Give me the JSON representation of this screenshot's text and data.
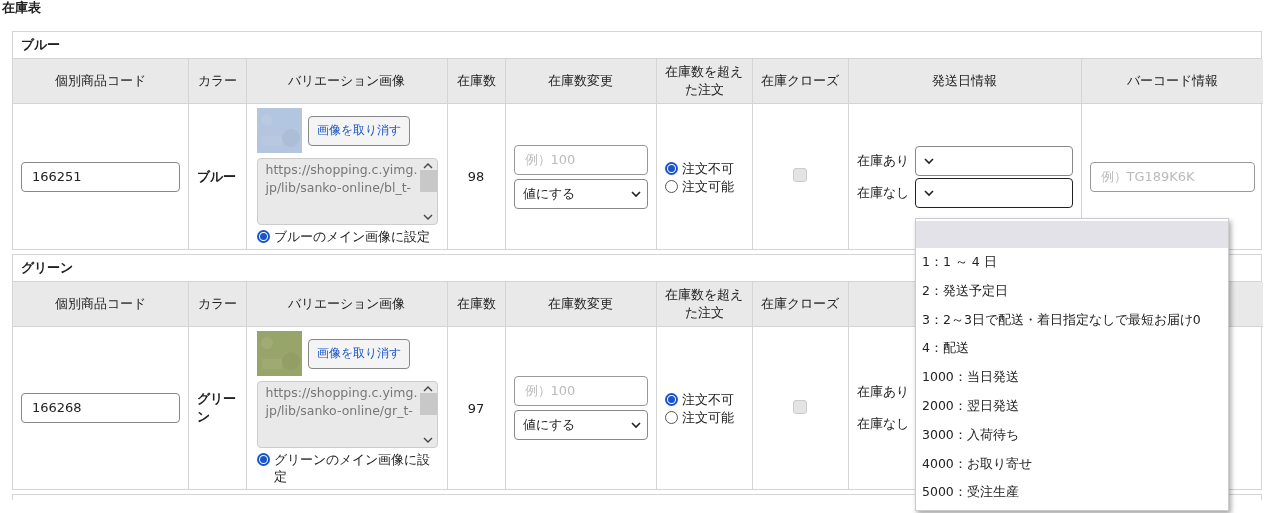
{
  "page_title": "在庫表",
  "sections": [
    {
      "title": "ブルー",
      "headers": [
        "個別商品コード",
        "カラー",
        "バリエーション画像",
        "在庫数",
        "在庫数変更",
        "在庫数を超えた注文",
        "在庫クローズ",
        "発送日情報",
        "バーコード情報"
      ],
      "code": "166251",
      "color_name": "ブルー",
      "image": {
        "kind": "picture",
        "color": "#b3c5df"
      },
      "cancel_button": "画像を取り消す",
      "url": "https://shopping.c.yimg.jp/lib/sanko-online/bl_t-",
      "main_image": {
        "label": "ブルーのメイン画像に設定",
        "selected": true
      },
      "stock": "98",
      "change_placeholder": "例）100",
      "change_mode": "値にする",
      "overorder": [
        {
          "label": "注文不可",
          "selected": true
        },
        {
          "label": "注文可能",
          "selected": false
        }
      ],
      "close": {
        "checked": false,
        "disabled": true
      },
      "shipping": [
        {
          "label": "在庫あり",
          "select": {
            "focused": false
          }
        },
        {
          "label": "在庫なし",
          "select": {
            "focused": true
          }
        }
      ],
      "barcode": {
        "placeholder": "例）TG189K6K"
      }
    },
    {
      "title": "グリーン",
      "headers": [
        "個別商品コード",
        "カラー",
        "バリエーション画像",
        "在庫数",
        "在庫数変更",
        "在庫数を超えた注文",
        "在庫クローズ"
      ],
      "code": "166268",
      "color_name": "グリーン",
      "image": {
        "kind": "picture",
        "color": "#98a56a"
      },
      "cancel_button": "画像を取り消す",
      "url": "https://shopping.c.yimg.jp/lib/sanko-online/gr_t-",
      "main_image": {
        "label": "グリーンのメイン画像に設定",
        "selected": true
      },
      "stock": "97",
      "change_placeholder": "例）100",
      "change_mode": "値にする",
      "overorder": [
        {
          "label": "注文不可",
          "selected": true
        },
        {
          "label": "注文可能",
          "selected": false
        }
      ],
      "close": {
        "checked": false,
        "disabled": true
      },
      "shipping": [
        {
          "label": "在庫あり"
        },
        {
          "label": "在庫なし"
        }
      ]
    }
  ],
  "dropdown": {
    "options": [
      {
        "kind": "blank",
        "selected": true
      },
      {
        "label": "1：1 ～ 4 日",
        "selected": false
      },
      {
        "label": "2：発送予定日",
        "selected": false
      },
      {
        "label": "3：2～3日で配送・着日指定なしで最短お届け0",
        "selected": false
      },
      {
        "label": "4：配送",
        "selected": false
      },
      {
        "label": "1000：当日発送",
        "selected": false
      },
      {
        "label": "2000：翌日発送",
        "selected": false
      },
      {
        "label": "3000：入荷待ち",
        "selected": false
      },
      {
        "label": "4000：お取り寄せ",
        "selected": false
      },
      {
        "label": "5000：受注生産",
        "selected": false
      }
    ]
  }
}
